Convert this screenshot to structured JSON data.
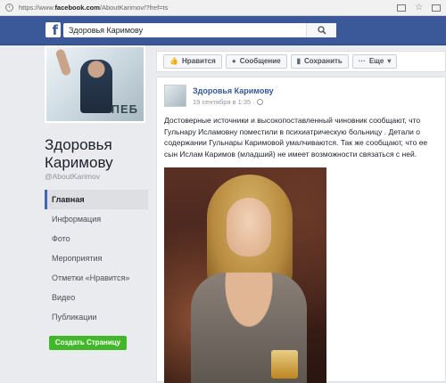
{
  "browser": {
    "url_prefix": "https://www.",
    "url_domain": "facebook.com",
    "url_path": "/AboutKarimov/?fref=ts"
  },
  "header": {
    "logo_letter": "f",
    "search_value": "Здоровья Каримову"
  },
  "page": {
    "name": "Здоровья Каримову",
    "handle": "@AboutKarimov"
  },
  "sidebar": {
    "items": [
      {
        "label": "Главная"
      },
      {
        "label": "Информация"
      },
      {
        "label": "Фото"
      },
      {
        "label": "Мероприятия"
      },
      {
        "label": "Отметки «Нравится»"
      },
      {
        "label": "Видео"
      },
      {
        "label": "Публикации"
      }
    ],
    "create_page_label": "Создать Страницу"
  },
  "actions": {
    "like_label": "Нравится",
    "message_label": "Сообщение",
    "save_label": "Сохранить",
    "more_label": "Еще"
  },
  "cover": {
    "overlay_text": "ПЕБ"
  },
  "post": {
    "author": "Здоровья Каримову",
    "date": "19 сентября в 1:35 ·",
    "text": "Достоверные источники и высокопоставленный чиновник сообщают, что Гульнару Исламовну поместили в психиатрическую больницу . Детали о содержании Гульнары Каримовой умалчиваются. Так же сообщают, что ее сын Ислам Каримов (младший) не имеет возможности связаться с ней."
  },
  "colors": {
    "brand": "#3b5998",
    "link": "#365899",
    "create_button": "#42b72a"
  }
}
